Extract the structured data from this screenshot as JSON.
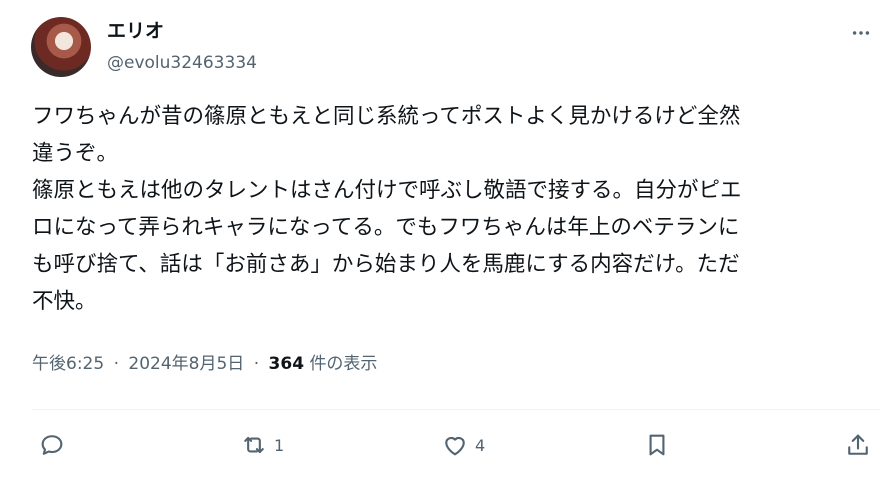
{
  "author": {
    "display_name": "エリオ",
    "handle": "@evolu32463334"
  },
  "post": {
    "lines": [
      "フワちゃんが昔の篠原ともえと同じ系統ってポストよく見かけるけど全然",
      "違うぞ。",
      "篠原ともえは他のタレントはさん付けで呼ぶし敬語で接する。自分がピエ",
      "ロになって弄られキャラになってる。でもフワちゃんは年上のベテランに",
      "も呼び捨て、話は「お前さあ」から始まり人を馬鹿にする内容だけ。ただ",
      "不快。"
    ]
  },
  "meta": {
    "time": "午後6:25",
    "separator": "·",
    "date": "2024年8月5日",
    "views_count": "364",
    "views_label": "件の表示"
  },
  "actions": {
    "reply_count": "",
    "repost_count": "1",
    "like_count": "4"
  },
  "icons": [
    "more-icon",
    "reply-icon",
    "repost-icon",
    "like-icon",
    "bookmark-icon",
    "share-icon"
  ]
}
